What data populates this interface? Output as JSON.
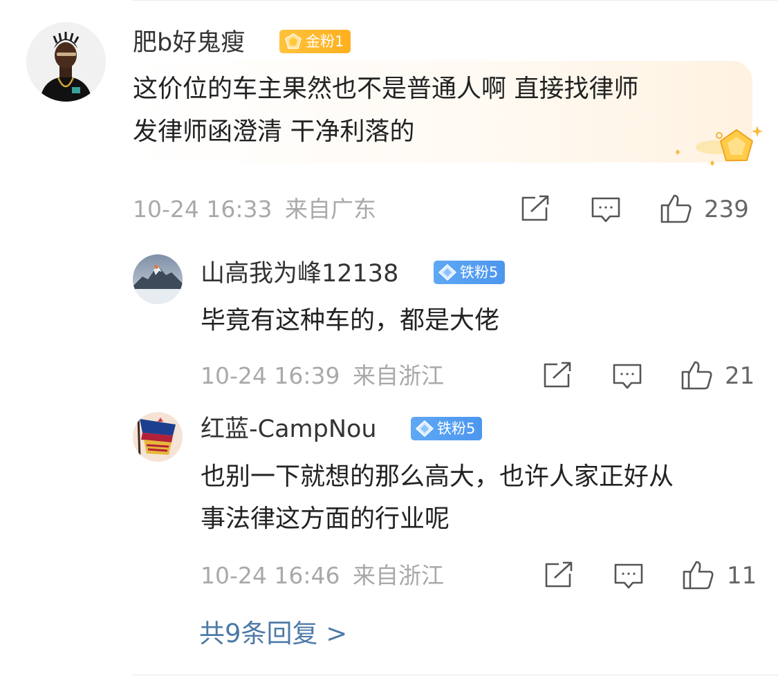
{
  "comment": {
    "user": "肥b好鬼瘦",
    "badge": "金粉1",
    "text_line1": "这价位的车主果然也不是普通人啊 直接找律师",
    "text_line2": "发律师函澄清 干净利落的",
    "time": "10-24 16:33",
    "location": "来自广东",
    "likes": "239"
  },
  "replies": [
    {
      "user": "山高我为峰12138",
      "badge": "铁粉5",
      "text_line1": "毕竟有这种车的，都是大佬",
      "time": "10-24 16:39",
      "location": "来自浙江",
      "likes": "21"
    },
    {
      "user": "红蓝-CampNou",
      "badge": "铁粉5",
      "text_line1": "也别一下就想的那么高大，也许人家正好从",
      "text_line2": "事法律这方面的行业呢",
      "time": "10-24 16:46",
      "location": "来自浙江",
      "likes": "11"
    }
  ],
  "more_replies": "共9条回复 >",
  "icons": {
    "share": "share-icon",
    "comment": "comment-icon",
    "like": "thumbs-up-icon",
    "gold_badge": "crown-icon",
    "iron_badge": "diamond-icon",
    "bubble_decoration": "gold-gem-icon"
  },
  "colors": {
    "link": "#4e7aa8",
    "gold_badge": "#ffb82e",
    "iron_badge": "#559ff2",
    "meta_text": "#a9a9a9"
  }
}
